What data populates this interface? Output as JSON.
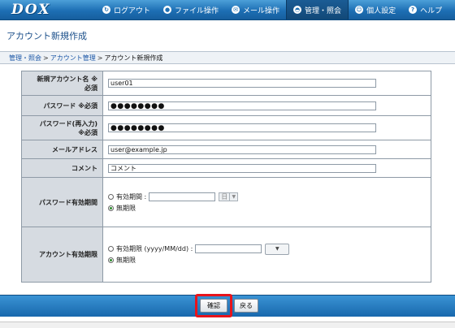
{
  "app": {
    "logo": "DOX"
  },
  "nav": {
    "items": [
      {
        "label": "ログアウト",
        "icon": "logout-icon",
        "glyph": "↻",
        "active": false
      },
      {
        "label": "ファイル操作",
        "icon": "file-icon",
        "glyph": "●",
        "active": false
      },
      {
        "label": "メール操作",
        "icon": "mail-icon",
        "glyph": "✉",
        "active": false
      },
      {
        "label": "管理・照会",
        "icon": "admin-icon",
        "glyph": "◓",
        "active": true
      },
      {
        "label": "個人設定",
        "icon": "user-icon",
        "glyph": "☺",
        "active": false
      },
      {
        "label": "ヘルプ",
        "icon": "help-icon",
        "glyph": "?",
        "active": false
      }
    ]
  },
  "page": {
    "title": "アカウント新規作成"
  },
  "breadcrumb": {
    "items": [
      "管理・照会",
      "アカウント管理",
      "アカウント新規作成"
    ],
    "separator": ">"
  },
  "form": {
    "new_account": {
      "label_line1": "新規アカウント名 ※",
      "label_line2": "必須",
      "value": "user01"
    },
    "password": {
      "label": "パスワード ※必須",
      "value": "●●●●●●●●"
    },
    "password_confirm": {
      "label_line1": "パスワード(再入力)",
      "label_line2": "※必須",
      "value": "●●●●●●●●"
    },
    "email": {
      "label": "メールアドレス",
      "value": "user@example.jp"
    },
    "comment": {
      "label": "コメント",
      "value": "コメント"
    },
    "password_expiry": {
      "label": "パスワード有効期間",
      "option_period": "有効期間 :",
      "option_unlimited": "無期限",
      "unit_select": "日",
      "selected": "unlimited"
    },
    "account_expiry": {
      "label": "アカウント有効期限",
      "option_period": "有効期限 (yyyy/MM/dd) :",
      "option_unlimited": "無期限",
      "selected": "unlimited"
    }
  },
  "footer": {
    "confirm_label": "確認",
    "back_label": "戻る"
  },
  "colors": {
    "accent": "#1d6fb4",
    "highlight": "#e8141b"
  }
}
